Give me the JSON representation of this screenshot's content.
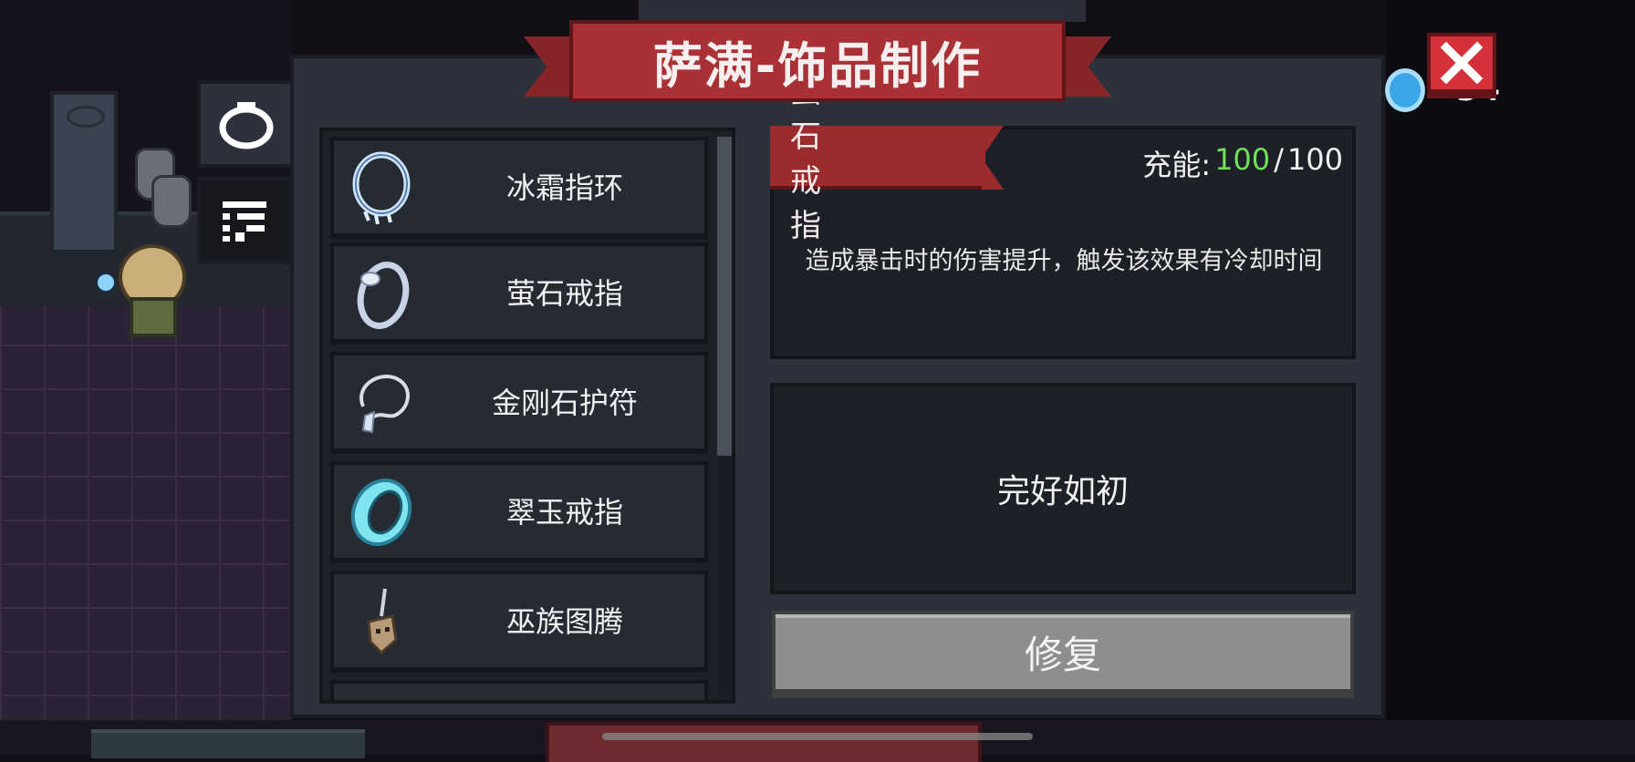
{
  "title": "萨满-饰品制作",
  "hud": {
    "coin_count": "54",
    "coin_icon": "gem-coin-icon"
  },
  "side_tabs": [
    {
      "name": "ring-category-icon",
      "active": true
    },
    {
      "name": "filter-category-icon",
      "active": false
    }
  ],
  "items": [
    {
      "label": "冰霜指环",
      "icon": "frost-ring-icon"
    },
    {
      "label": "萤石戒指",
      "icon": "fluorite-ring-icon"
    },
    {
      "label": "金刚石护符",
      "icon": "diamond-amulet-icon"
    },
    {
      "label": "翠玉戒指",
      "icon": "jade-ring-icon"
    },
    {
      "label": "巫族图腾",
      "icon": "witch-totem-icon"
    }
  ],
  "detail": {
    "name": "萤石戒指",
    "charge_label": "充能:",
    "charge_current": "100",
    "charge_sep": "/",
    "charge_max": "100",
    "description": "造成暴击时的伤害提升，触发该效果有冷却时间",
    "status": "完好如初",
    "action_button": "修复"
  },
  "colors": {
    "accent_red": "#a93034",
    "charge_green": "#6fe05a",
    "panel": "#2c313c"
  }
}
